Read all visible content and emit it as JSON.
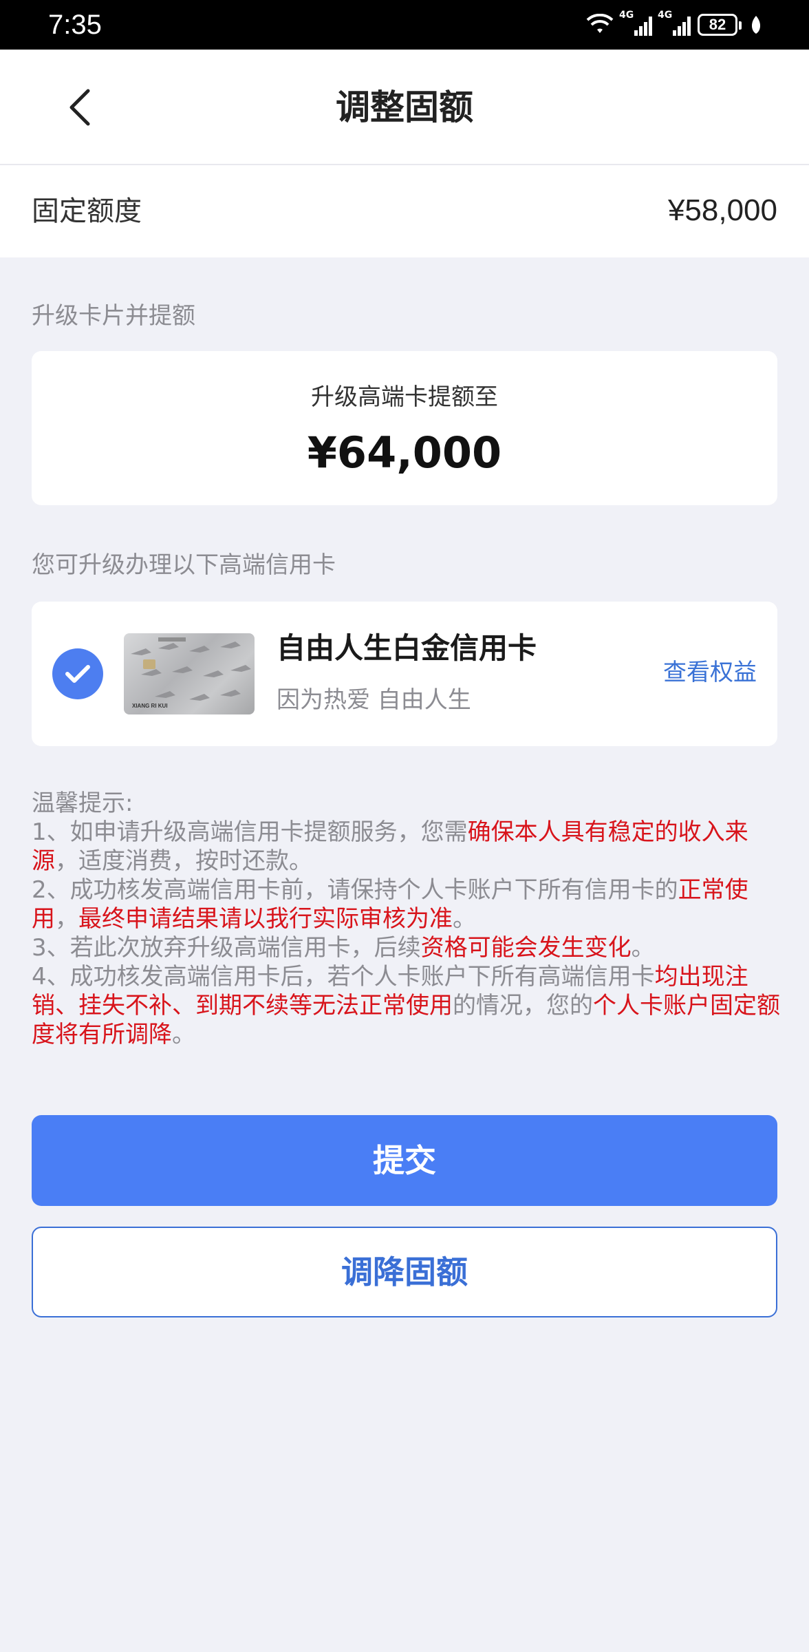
{
  "status_bar": {
    "time": "7:35",
    "signal1": "4G",
    "signal2": "4G",
    "battery": "82",
    "icons": [
      "wifi-icon",
      "signal-icon",
      "signal-icon",
      "battery-icon",
      "leaf-icon"
    ]
  },
  "nav": {
    "title": "调整固额",
    "back_icon": "chevron-left-icon"
  },
  "fixed_quota": {
    "label": "固定额度",
    "value": "¥58,000"
  },
  "upgrade_section": {
    "title": "升级卡片并提额",
    "subtitle": "升级高端卡提额至",
    "amount": "¥64,000"
  },
  "card_section": {
    "title": "您可升级办理以下高端信用卡",
    "card_name": "自由人生白金信用卡",
    "card_slogan": "因为热爱 自由人生",
    "view_link": "查看权益",
    "selected": true,
    "card_text": "XIANG RI KUI"
  },
  "tips": {
    "heading": "温馨提示:",
    "item1_a": "1、如申请升级高端信用卡提额服务，您需",
    "item1_b": "确保本人具有稳定的收入来源",
    "item1_c": "，适度消费，按时还款。",
    "item2_a": "2、成功核发高端信用卡前，请保持个人卡账户下所有信用卡的",
    "item2_b": "正常使用",
    "item2_c": "，",
    "item2_d": "最终申请结果请以我行实际审核为准",
    "item2_e": "。",
    "item3_a": "3、若此次放弃升级高端信用卡，后续",
    "item3_b": "资格可能会发生变化",
    "item3_c": "。",
    "item4_a": "4、成功核发高端信用卡后，若个人卡账户下所有高端信用卡",
    "item4_b": "均出现注销、挂失不补、到期不续等无法正常使用",
    "item4_c": "的情况，您的",
    "item4_d": "个人卡账户固定额度将有所调降",
    "item4_e": "。"
  },
  "buttons": {
    "submit": "提交",
    "lower": "调降固额"
  },
  "colors": {
    "primary": "#4a7ef5",
    "link": "#3a72d6",
    "warning": "#d8141b",
    "background": "#f0f1f7"
  }
}
